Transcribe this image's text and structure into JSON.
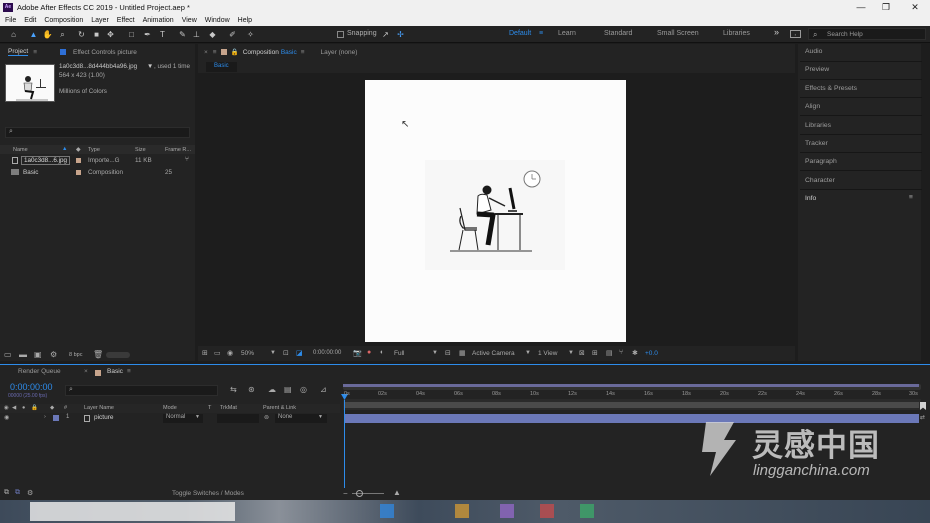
{
  "window": {
    "app_icon": "Ae",
    "title": "Adobe After Effects CC 2019 - Untitled Project.aep *",
    "min_glyph": "—",
    "max_glyph": "❐",
    "close_glyph": "✕"
  },
  "menu": [
    "File",
    "Edit",
    "Composition",
    "Layer",
    "Effect",
    "Animation",
    "View",
    "Window",
    "Help"
  ],
  "toolbar": {
    "snapping_label": "Snapping",
    "workspaces": [
      "Default",
      "Learn",
      "Standard",
      "Small Screen",
      "Libraries"
    ],
    "more_glyph": "»",
    "search_placeholder": "Search Help",
    "accent": "#2d8ceb"
  },
  "project_panel": {
    "tab_project": "Project",
    "tab_effect_controls": "Effect Controls picture",
    "selected_name": "1a0c3d8...8d444bb4a96.jpg",
    "used_times": ", used 1 time",
    "dimensions": "564 x 423 (1.00)",
    "colors": "Millions of Colors",
    "columns": [
      "Name",
      "Type",
      "Size",
      "Frame R..."
    ],
    "items": [
      {
        "name": "1a0c3d8...6.jpg",
        "type": "Importe...G",
        "size": "11 KB",
        "frame_rate": ""
      },
      {
        "name": "Basic",
        "type": "Composition",
        "size": "",
        "frame_rate": "25"
      }
    ],
    "bpc": "8 bpc"
  },
  "composition_panel": {
    "tab_label": "Composition",
    "comp_name": "Basic",
    "layer_tab": "Layer (none)",
    "breadcrumb": "Basic",
    "zoom": "50%",
    "timecode": "0:00:00:00",
    "resolution": "Full",
    "camera": "Active Camera",
    "views": "1 View",
    "offset": "+0.0"
  },
  "right_panel": {
    "items": [
      "Audio",
      "Preview",
      "Effects & Presets",
      "Align",
      "Libraries",
      "Tracker",
      "Paragraph",
      "Character",
      "Info"
    ]
  },
  "timeline": {
    "tab_render_queue": "Render Queue",
    "tab_comp": "Basic",
    "timecode": "0:00:00:00",
    "frames": "00000 (25.00 fps)",
    "columns": {
      "hash": "#",
      "layer_name": "Layer Name",
      "mode": "Mode",
      "t": "T",
      "trkmat": "TrkMat",
      "parent": "Parent & Link"
    },
    "layer": {
      "index": "1",
      "name": "picture",
      "mode": "Normal",
      "parent": "None"
    },
    "ruler": [
      "0s",
      "02s",
      "04s",
      "06s",
      "08s",
      "10s",
      "12s",
      "14s",
      "16s",
      "18s",
      "20s",
      "22s",
      "24s",
      "26s",
      "28s",
      "30s"
    ],
    "toggle_label": "Toggle Switches / Modes",
    "accent": "#6b78b8"
  },
  "watermark": {
    "cn": "灵感中国",
    "url": "lingganchina.com"
  }
}
